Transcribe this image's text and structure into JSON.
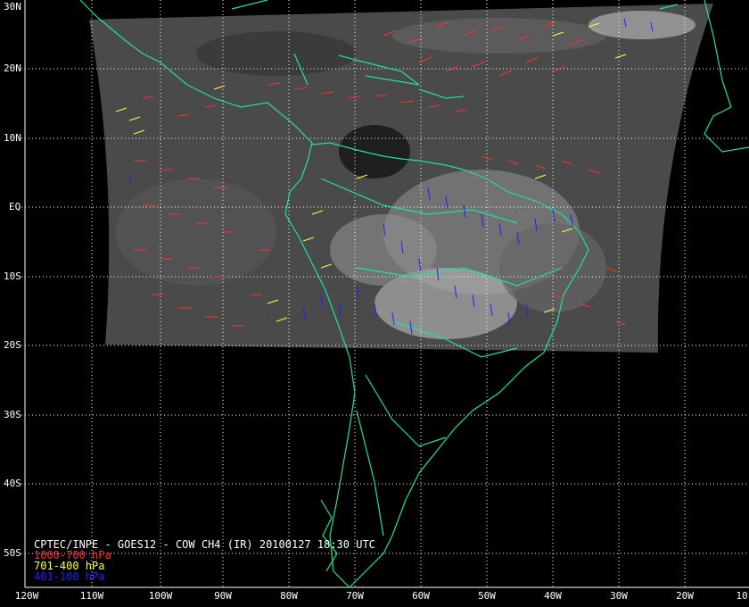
{
  "title": "CPTEC/INPE - GOES12 - COW CH4 (IR) 20100127 18:30 UTC",
  "legend": [
    {
      "label": "1000-700 hPa",
      "color": "#ff3030"
    },
    {
      "label": "701-400 hPa",
      "color": "#ffff40"
    },
    {
      "label": "401-100 hPa",
      "color": "#2020ff"
    }
  ],
  "lat_labels": [
    "30N",
    "20N",
    "10N",
    "EQ",
    "10S",
    "20S",
    "30S",
    "40S",
    "50S"
  ],
  "lon_labels": [
    "120W",
    "110W",
    "100W",
    "90W",
    "80W",
    "70W",
    "60W",
    "50W",
    "40W",
    "30W",
    "20W",
    "10"
  ],
  "colors": {
    "coast": "#20e0a0",
    "grid": "#ffffff",
    "background": "#000000",
    "ir_panel": "#4a4a4a"
  }
}
